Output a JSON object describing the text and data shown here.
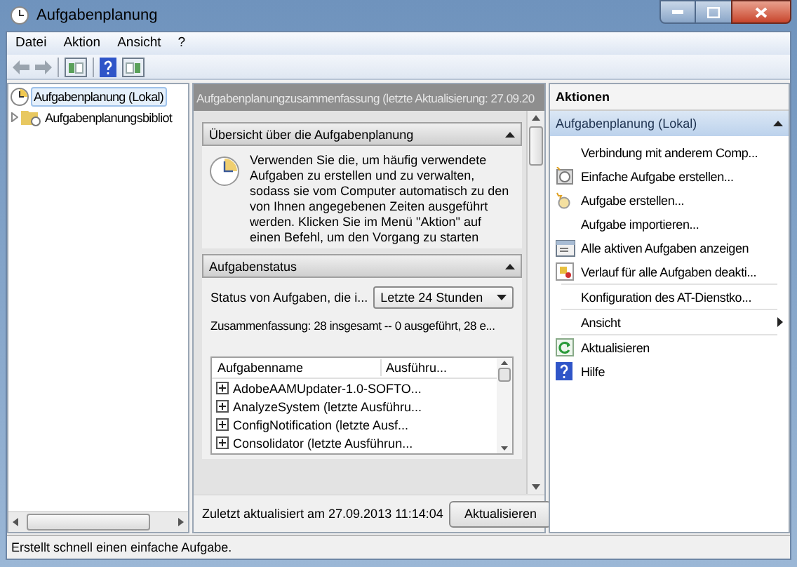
{
  "window": {
    "title": "Aufgabenplanung"
  },
  "menu": [
    "Datei",
    "Aktion",
    "Ansicht",
    "?"
  ],
  "tree": [
    {
      "label": "Aufgabenplanung (Lokal)",
      "selected": true
    },
    {
      "label": "Aufgabenplanungsbibliot",
      "selected": false,
      "expanded": false
    }
  ],
  "summary": {
    "header": "Aufgabenplanungzusammenfassung (letzte Aktualisierung: 27.09.20",
    "overview": {
      "title": "Übersicht über die Aufgabenplanung",
      "expanded": true,
      "text": "Verwenden Sie die, um häufig verwendete Aufgaben zu erstellen und zu verwalten, sodass sie vom Computer automatisch zu den von Ihnen angegebenen Zeiten ausgeführt werden. Klicken Sie im Menü \"Aktion\" auf einen Befehl, um den Vorgang zu starten"
    },
    "status": {
      "title": "Aufgabenstatus",
      "expanded": true,
      "filter_label": "Status von Aufgaben, die i...",
      "filter_value": "Letzte 24 Stunden",
      "summary_text": "Zusammenfassung: 28 insgesamt -- 0 ausgeführt, 28 e...",
      "table": {
        "columns": [
          "Aufgabenname",
          "Ausführu..."
        ],
        "rows": [
          {
            "name": "AdobeAAMUpdater-1.0-SOFTO...",
            "expanded": false
          },
          {
            "name": "AnalyzeSystem (letzte Ausführu...",
            "expanded": false
          },
          {
            "name": "ConfigNotification (letzte Ausf...",
            "expanded": false
          },
          {
            "name": "Consolidator (letzte Ausführun...",
            "expanded": false
          }
        ]
      }
    },
    "footer": {
      "text": "Zuletzt aktualisiert am 27.09.2013 11:14:04",
      "button": "Aktualisieren"
    }
  },
  "actions": {
    "title": "Aktionen",
    "group": {
      "label": "Aufgabenplanung (Lokal)",
      "expanded": true
    },
    "items": [
      {
        "label": "Verbindung mit anderem Comp...",
        "kind": "plain",
        "divider_after": false
      },
      {
        "label": "Einfache Aufgabe erstellen...",
        "kind": "wizard",
        "divider_after": false
      },
      {
        "label": "Aufgabe erstellen...",
        "kind": "new",
        "divider_after": false
      },
      {
        "label": "Aufgabe importieren...",
        "kind": "plain",
        "divider_after": false
      },
      {
        "label": "Alle aktiven Aufgaben anzeigen",
        "kind": "list",
        "divider_after": false
      },
      {
        "label": "Verlauf für alle Aufgaben deakti...",
        "kind": "history",
        "divider_after": true
      },
      {
        "label": "Konfiguration des AT-Dienstko...",
        "kind": "plain",
        "divider_after": true
      },
      {
        "label": "Ansicht",
        "kind": "submenu",
        "divider_after": true
      },
      {
        "label": "Aktualisieren",
        "kind": "refresh",
        "divider_after": false
      },
      {
        "label": "Hilfe",
        "kind": "help",
        "divider_after": false
      }
    ]
  },
  "status_bar": "Erstellt schnell einen einfache Aufgabe."
}
